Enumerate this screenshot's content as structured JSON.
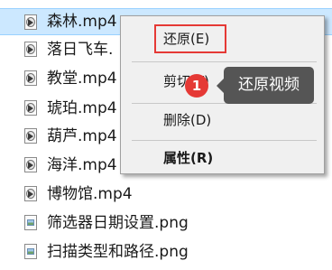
{
  "files": [
    {
      "name": "森林.mp4",
      "type": "video",
      "selected": true
    },
    {
      "name": "落日飞车.",
      "type": "video",
      "selected": false
    },
    {
      "name": "教堂.mp4",
      "type": "video",
      "selected": false
    },
    {
      "name": "琥珀.mp4",
      "type": "video",
      "selected": false
    },
    {
      "name": "葫芦.mp4",
      "type": "video",
      "selected": false
    },
    {
      "name": "海洋.mp4",
      "type": "video",
      "selected": false
    },
    {
      "name": "博物馆.mp4",
      "type": "video",
      "selected": false
    },
    {
      "name": "筛选器日期设置.png",
      "type": "image",
      "selected": false
    },
    {
      "name": "扫描类型和路径.png",
      "type": "image",
      "selected": false
    }
  ],
  "context_menu": {
    "restore": "还原(E)",
    "cut": "剪切(T)",
    "delete": "删除(D)",
    "properties": "属性(R)"
  },
  "callout": {
    "badge": "1",
    "tooltip": "还原视频"
  },
  "colors": {
    "selection": "#cce8ff",
    "highlight": "#e53935",
    "tooltip": "#555555"
  }
}
